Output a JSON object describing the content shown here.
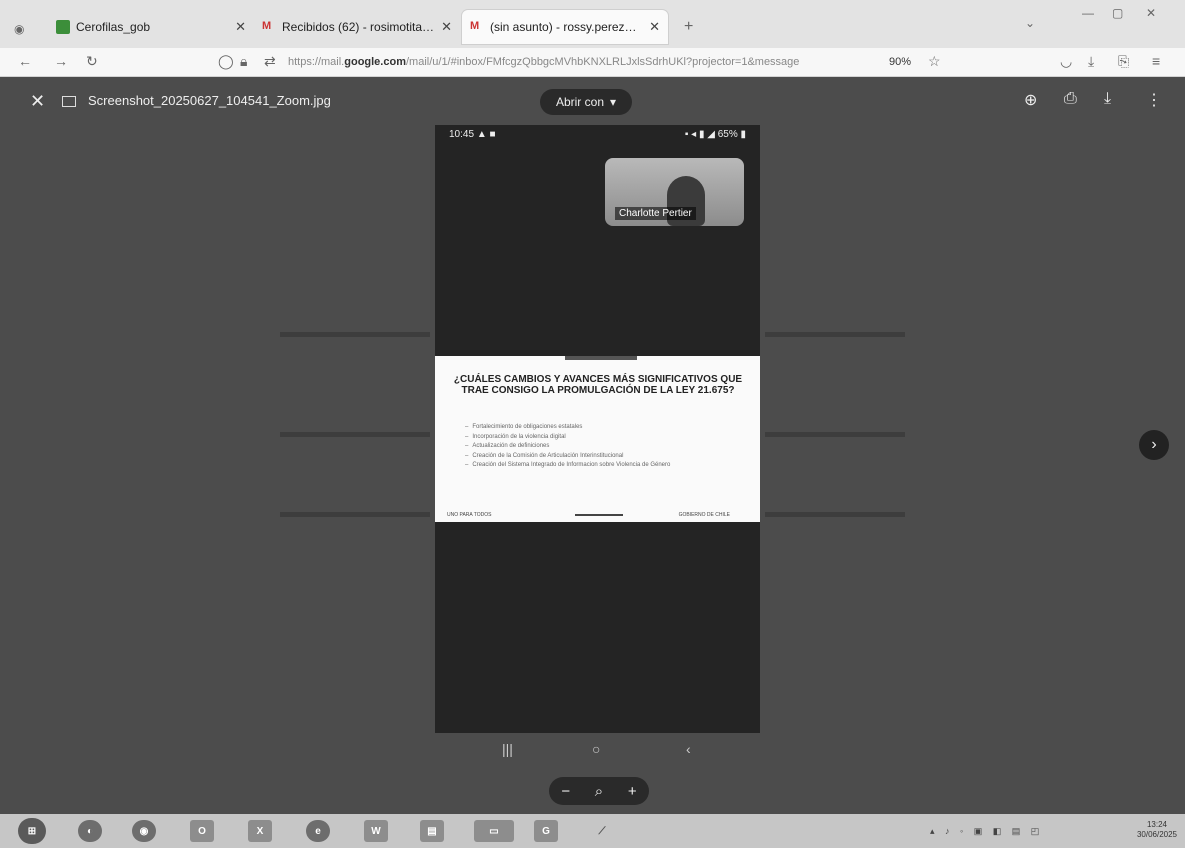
{
  "browser": {
    "tabs": [
      {
        "label": "Cerofilas_gob",
        "icon": "green-square-icon",
        "active": false
      },
      {
        "label": "Recibidos (62) - rosimotita2021",
        "icon": "gmail-icon",
        "active": false
      },
      {
        "label": "(sin asunto) - rossy.perezp14@",
        "icon": "gmail-icon",
        "active": true
      }
    ],
    "new_tab": "+",
    "url_prefix": "https://mail.",
    "url_domain": "google.com",
    "url_rest": "/mail/u/1/#inbox/FMfcgzQbbgcMVhbKNXLRLJxlsSdrhUKl?projector=1&message",
    "zoom": "90%"
  },
  "viewer": {
    "filename": "Screenshot_20250627_104541_Zoom.jpg",
    "open_with": "Abrir con",
    "phone": {
      "time": "10:45",
      "battery": "65%",
      "participant": "Charlotte Pertier",
      "slide_title": "¿CUÁLES CAMBIOS Y AVANCES MÁS SIGNIFICATIVOS QUE TRAE CONSIGO LA PROMULGACIÓN DE LA LEY 21.675?",
      "bullets": [
        "Fortalecimiento de obligaciones estatales",
        "Incorporación de la violencia digital",
        "Actualización de definiciones",
        "Creación de la Comisión de Articulación Interinstitucional",
        "Creación del Sistema Integrado de Informacion sobre Violencia de Género"
      ],
      "slide_footer_left": "UNO PARA TODOS",
      "slide_footer_right": "GOBIERNO DE CHILE"
    }
  },
  "taskbar": {
    "clock_time": "13:24",
    "clock_date": "30/06/2025"
  }
}
